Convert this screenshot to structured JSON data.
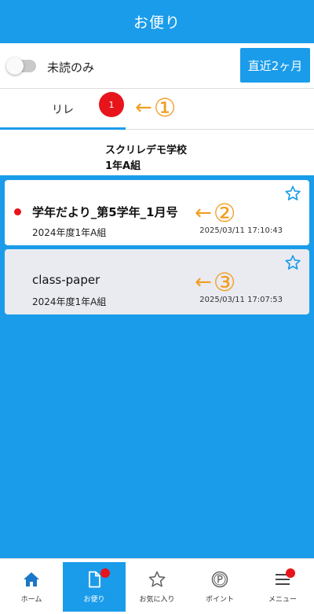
{
  "header": {
    "title": "お便り"
  },
  "filter": {
    "unread_only_label": "未読のみ",
    "period_button_label": "直近2ヶ月"
  },
  "tabs": [
    {
      "label": "リレ",
      "badge": "1"
    }
  ],
  "annotations": [
    {
      "arrow": "←",
      "number": "①"
    },
    {
      "arrow": "←",
      "number": "②"
    },
    {
      "arrow": "←",
      "number": "③"
    }
  ],
  "school": {
    "name": "スクリレデモ学校",
    "class": "1年A組"
  },
  "letters": [
    {
      "title": "学年だより_第5学年_1月号",
      "subtitle": "2024年度1年A組",
      "datetime": "2025/03/11 17:10:43",
      "unread": true,
      "icon": "star-outline-icon"
    },
    {
      "title": "class-paper",
      "subtitle": "2024年度1年A組",
      "datetime": "2025/03/11 17:07:53",
      "unread": false,
      "icon": "star-outline-icon"
    }
  ],
  "nav": [
    {
      "label": "ホーム",
      "icon": "home-icon"
    },
    {
      "label": "お便り",
      "icon": "document-icon"
    },
    {
      "label": "お気に入り",
      "icon": "star-outline-icon"
    },
    {
      "label": "ポイント",
      "icon": "point-icon"
    },
    {
      "label": "メニュー",
      "icon": "menu-icon"
    }
  ],
  "colors": {
    "primary": "#1b9cea",
    "badge": "#e8141b",
    "annotation": "#f39c1f",
    "read_card": "#e9ebf1"
  }
}
